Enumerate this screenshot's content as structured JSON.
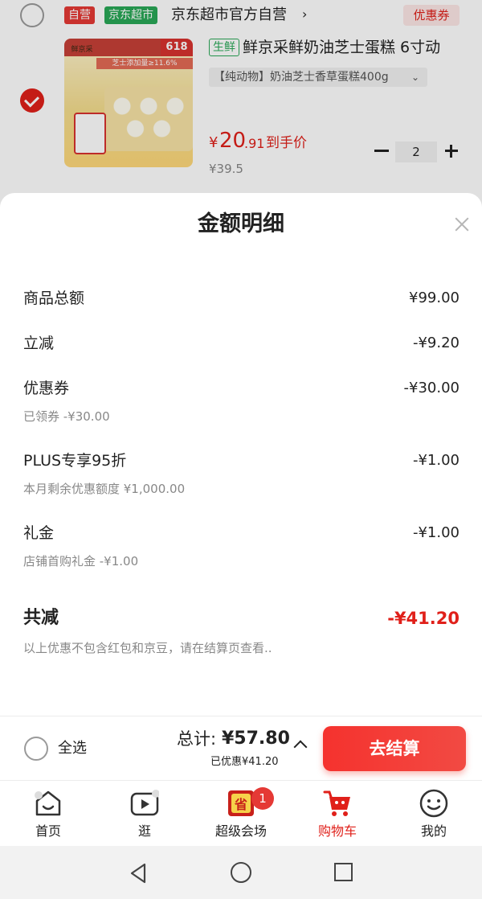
{
  "cart": {
    "shop": {
      "tag_ziying": "自营",
      "tag_supermarket": "京东超市",
      "name": "京东超市官方自营",
      "arrow": "›",
      "coupon_label": "优惠券"
    },
    "item": {
      "image_badge": "618",
      "image_stripe": "芝士添加量≥11.6%",
      "image_brand": "鲜京采",
      "tag": "生鲜",
      "title": "鲜京采鲜奶油芝士蛋糕 6寸动",
      "variant": "【纯动物】奶油芝士香草蛋糕400g",
      "variant_chevron": "⌄",
      "price_symbol": "¥",
      "price_int": "20",
      "price_dec": ".91",
      "price_label": "到手价",
      "original_price": "¥39.5",
      "quantity": "2",
      "checked": true
    }
  },
  "sheet": {
    "title": "金额明细",
    "rows": [
      {
        "label": "商品总额",
        "value": "¥99.00",
        "sub": ""
      },
      {
        "label": "立减",
        "value": "-¥9.20",
        "sub": ""
      },
      {
        "label": "优惠券",
        "value": "-¥30.00",
        "sub": "已领券 -¥30.00"
      },
      {
        "label": "PLUS专享95折",
        "value": "-¥1.00",
        "sub": "本月剩余优惠额度 ¥1,000.00"
      },
      {
        "label": "礼金",
        "value": "-¥1.00",
        "sub": "店铺首购礼金 -¥1.00"
      }
    ],
    "total_label": "共减",
    "total_value": "-¥41.20",
    "note": "以上优惠不包含红包和京豆，请在结算页查看.."
  },
  "checkout": {
    "select_all": "全选",
    "sum_label": "总计:",
    "sum_value": "¥57.80",
    "saved": "已优惠¥41.20",
    "button": "去结算"
  },
  "tabs": [
    {
      "label": "首页",
      "icon": "home-icon",
      "active": false
    },
    {
      "label": "逛",
      "icon": "video-play-icon",
      "active": false
    },
    {
      "label": "超级会场",
      "icon": "sale-venue-icon",
      "active": false,
      "badge": "1",
      "icon_text": "省"
    },
    {
      "label": "购物车",
      "icon": "cart-icon",
      "active": true
    },
    {
      "label": "我的",
      "icon": "profile-face-icon",
      "active": false
    }
  ],
  "colors": {
    "accent": "#e0201a",
    "green": "#2aa857",
    "checkout_button": "#f5322e"
  }
}
